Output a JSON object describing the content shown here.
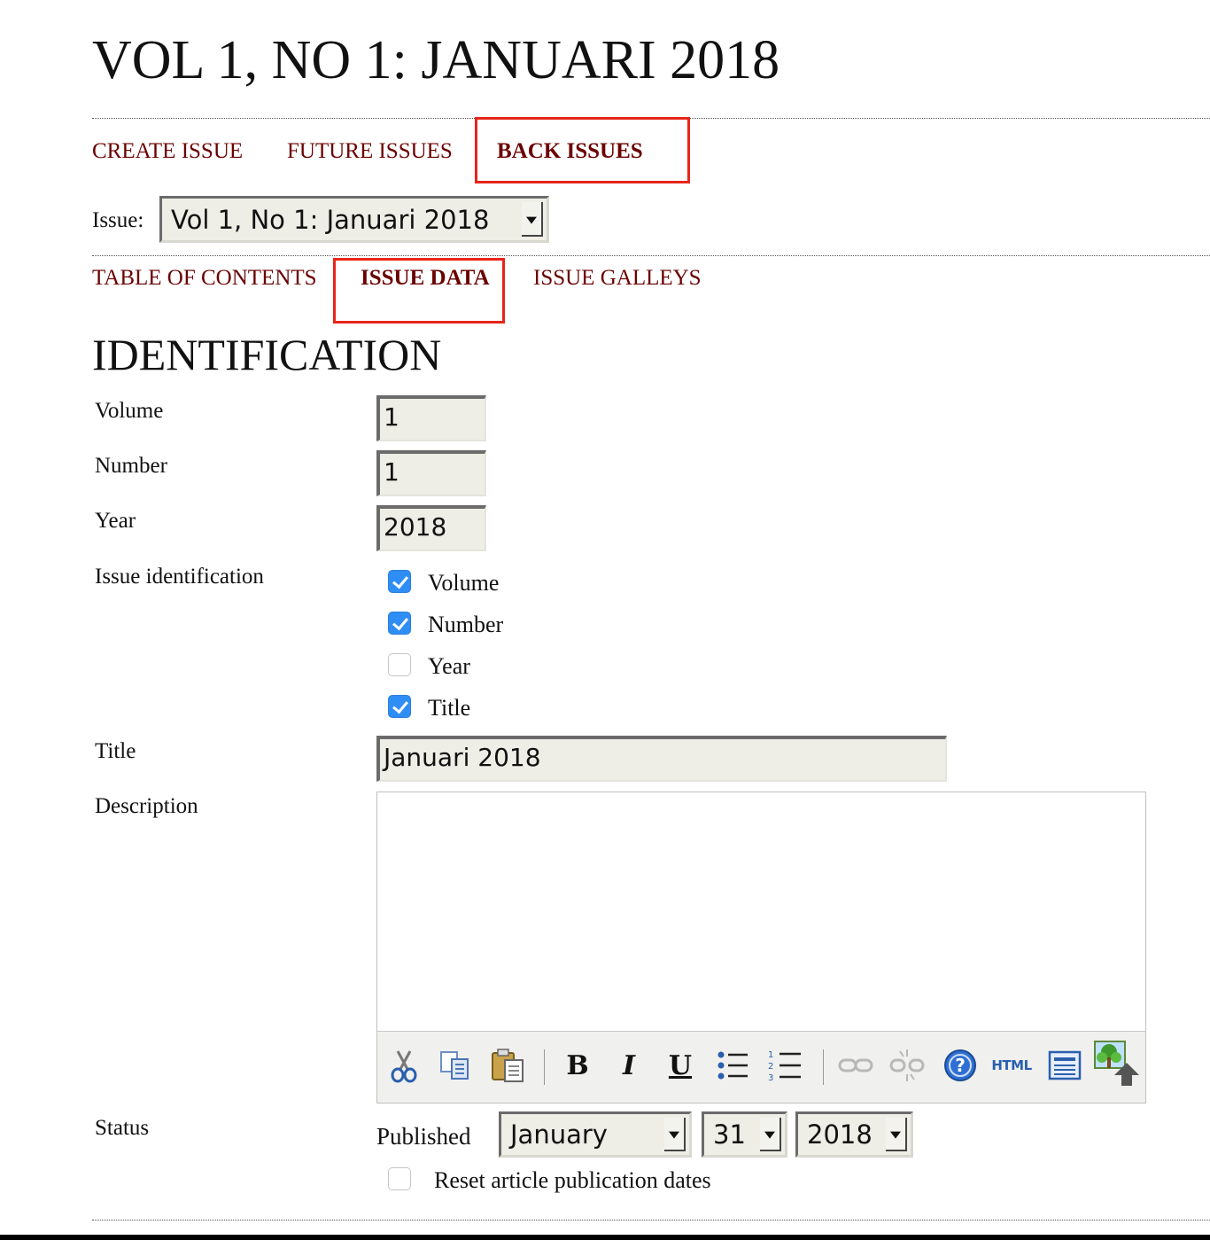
{
  "page": {
    "title": "VOL 1, NO 1: JANUARI 2018"
  },
  "nav": {
    "items": [
      {
        "label": "CREATE ISSUE"
      },
      {
        "label": "FUTURE ISSUES"
      },
      {
        "label": "BACK ISSUES",
        "current": true
      }
    ]
  },
  "issue_selector": {
    "label": "Issue:",
    "value": "Vol 1, No 1: Januari 2018"
  },
  "subnav": {
    "items": [
      {
        "label": "TABLE OF CONTENTS"
      },
      {
        "label": "ISSUE DATA",
        "current": true
      },
      {
        "label": "ISSUE GALLEYS"
      }
    ]
  },
  "identification": {
    "heading": "IDENTIFICATION",
    "volume": {
      "label": "Volume",
      "value": "1"
    },
    "number": {
      "label": "Number",
      "value": "1"
    },
    "year": {
      "label": "Year",
      "value": "2018"
    },
    "issue_identification": {
      "label": "Issue identification",
      "options": [
        {
          "label": "Volume",
          "checked": true
        },
        {
          "label": "Number",
          "checked": true
        },
        {
          "label": "Year",
          "checked": false
        },
        {
          "label": "Title",
          "checked": true
        }
      ]
    },
    "title": {
      "label": "Title",
      "value": "Januari 2018"
    },
    "description": {
      "label": "Description",
      "value": "",
      "toolbar": [
        "cut-icon",
        "copy-icon",
        "paste-icon",
        "bold-icon",
        "italic-icon",
        "underline-icon",
        "bullet-list-icon",
        "numbered-list-icon",
        "link-icon",
        "unlink-icon",
        "help-icon",
        "html-icon",
        "fullscreen-icon",
        "image-icon"
      ]
    },
    "status": {
      "label": "Status",
      "published_label": "Published",
      "month": "January",
      "day": "31",
      "year": "2018",
      "reset_label": "Reset article publication dates",
      "reset_checked": false
    }
  },
  "colors": {
    "link": "#6b0000",
    "highlight": "#e8251a",
    "checkbox": "#2f8ef5"
  }
}
